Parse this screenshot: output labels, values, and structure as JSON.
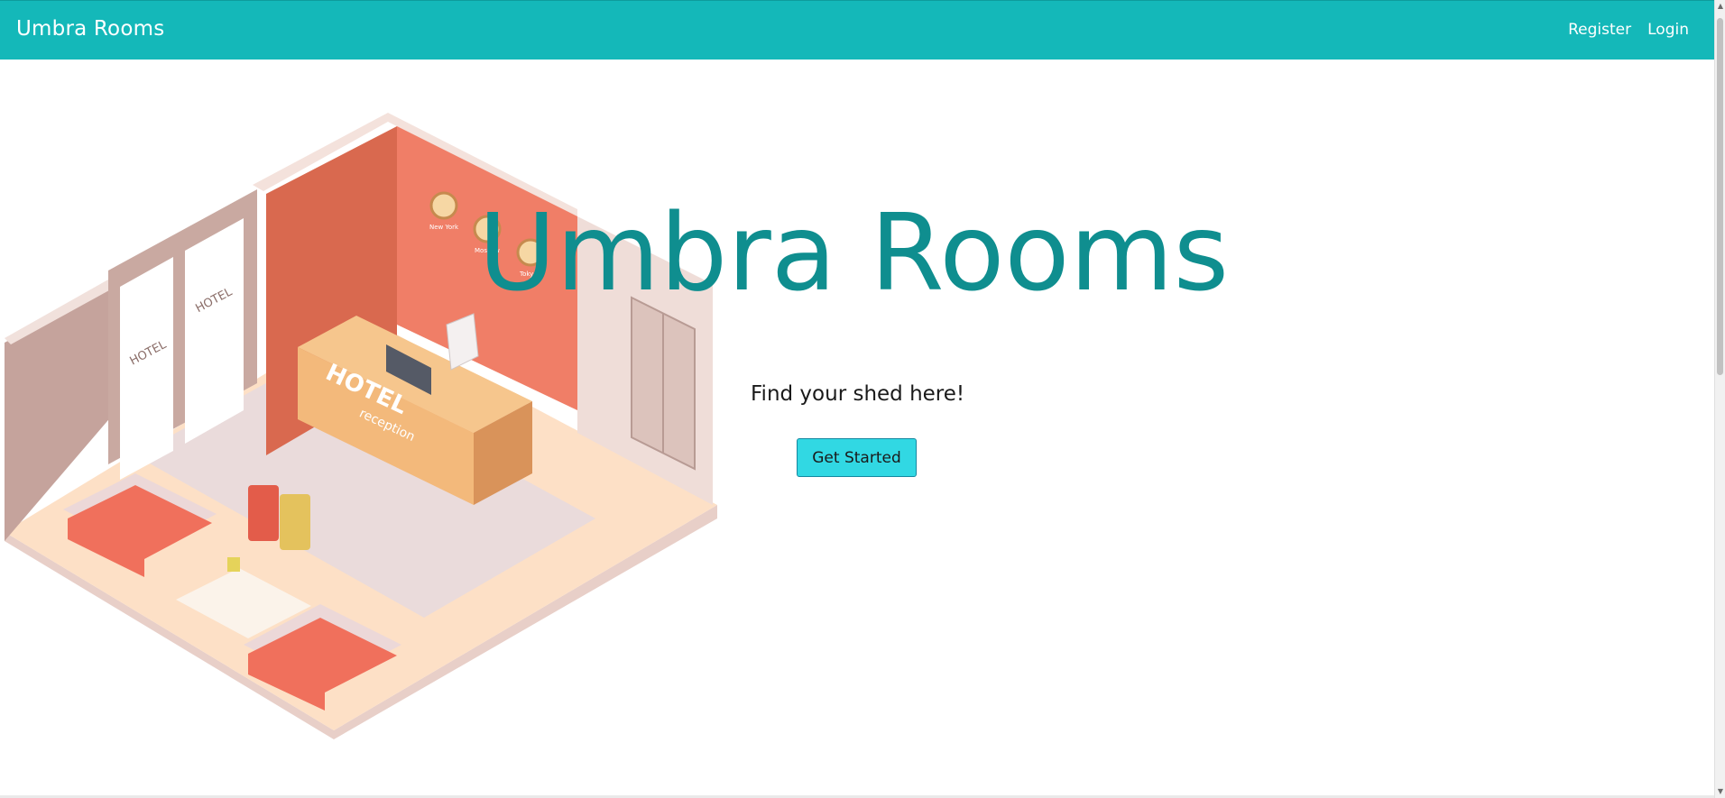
{
  "navbar": {
    "brand": "Umbra Rooms",
    "links": [
      {
        "label": "Register"
      },
      {
        "label": "Login"
      }
    ],
    "background": "#14b8b9"
  },
  "hero": {
    "title": "Umbra Rooms",
    "subtitle": "Find your shed here!",
    "cta_label": "Get Started",
    "title_color": "#0f8e8f",
    "cta_color": "#31d8e3"
  },
  "illustration": {
    "desk_label": "HOTEL",
    "desk_sublabel": "reception",
    "window_sign": "HOTEL",
    "clock_labels": [
      "New York",
      "Moscow",
      "Tokyo"
    ]
  },
  "scrollbar": {
    "up_icon": "arrow-up-icon",
    "down_icon": "arrow-down-icon"
  }
}
